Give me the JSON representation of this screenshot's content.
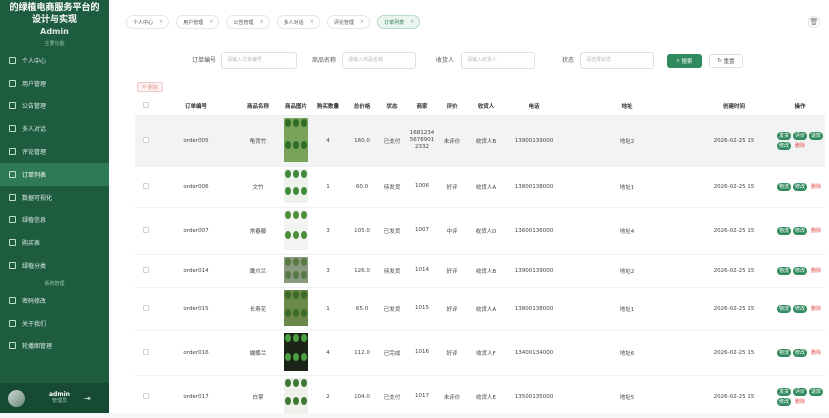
{
  "sidebar": {
    "title": "的绿植电商服务平台的设计与实现",
    "subtitle": "Admin",
    "section_main": "主要功能",
    "section_system": "系统管理",
    "items": [
      {
        "label": "个人中心",
        "icon": "user-icon"
      },
      {
        "label": "用户管理",
        "icon": "users-icon"
      },
      {
        "label": "公告管理",
        "icon": "notice-icon"
      },
      {
        "label": "多人对话",
        "icon": "chat-icon"
      },
      {
        "label": "评论管理",
        "icon": "comment-icon"
      },
      {
        "label": "订单列表",
        "icon": "order-icon"
      },
      {
        "label": "数据可视化",
        "icon": "chart-icon"
      },
      {
        "label": "绿植信息",
        "icon": "plant-icon"
      },
      {
        "label": "购买表",
        "icon": "cart-icon"
      },
      {
        "label": "绿植分类",
        "icon": "category-icon"
      }
    ],
    "system_items": [
      {
        "label": "密码修改",
        "icon": "lock-icon"
      },
      {
        "label": "关于我们",
        "icon": "info-icon"
      },
      {
        "label": "轮播图管理",
        "icon": "image-icon"
      }
    ],
    "user": {
      "name": "admin",
      "role": "管理员"
    }
  },
  "tabs": [
    {
      "label": "个人中心"
    },
    {
      "label": "用户管理"
    },
    {
      "label": "公告管理"
    },
    {
      "label": "多人对话"
    },
    {
      "label": "评论管理"
    },
    {
      "label": "订单列表"
    }
  ],
  "filters": {
    "order_no_label": "订单编号",
    "order_no_placeholder": "请输入订单编号",
    "product_label": "商品名称",
    "product_placeholder": "请输入商品名称",
    "receiver_label": "收货人",
    "receiver_placeholder": "请输入收货人",
    "status_label": "状态",
    "status_placeholder": "请选择状态",
    "search_label": "搜索",
    "reset_label": "重置",
    "delete_label": "删除"
  },
  "table": {
    "headers": [
      "",
      "订单编号",
      "商品名称",
      "商品图片",
      "购买数量",
      "总价格",
      "状态",
      "商家",
      "评价",
      "收货人",
      "电话",
      "地址",
      "创建时间",
      "操作"
    ],
    "rows": [
      {
        "order_no": "order005",
        "product": "龟背竹",
        "qty": "4",
        "total": "160.0",
        "status": "已支付",
        "merchant": "1681234 5678901 2332",
        "review": "未评价",
        "receiver": "收货人B",
        "phone": "13900139000",
        "address": "地址2",
        "created": "2026-02-25 15",
        "ops": [
          "发货",
          "评价",
          "退款",
          "修改",
          "删除"
        ]
      },
      {
        "order_no": "order006",
        "product": "文竹",
        "qty": "1",
        "total": "60.0",
        "status": "待发货",
        "merchant": "1006",
        "review": "好评",
        "receiver": "收货人A",
        "phone": "13800138000",
        "address": "地址1",
        "created": "2026-02-25 15",
        "ops": [
          "物流",
          "修改",
          "删除"
        ]
      },
      {
        "order_no": "order007",
        "product": "常春藤",
        "qty": "3",
        "total": "105.0",
        "status": "已发货",
        "merchant": "1007",
        "review": "中评",
        "receiver": "收货人D",
        "phone": "13600136000",
        "address": "地址4",
        "created": "2026-02-25 15",
        "ops": [
          "物流",
          "修改",
          "删除"
        ]
      },
      {
        "order_no": "order014",
        "product": "鹰爪兰",
        "qty": "3",
        "total": "126.0",
        "status": "待发货",
        "merchant": "1014",
        "review": "好评",
        "receiver": "收货人B",
        "phone": "13900139000",
        "address": "地址2",
        "created": "2026-02-25 15",
        "ops": [
          "物流",
          "修改",
          "删除"
        ]
      },
      {
        "order_no": "order015",
        "product": "长寿花",
        "qty": "1",
        "total": "65.0",
        "status": "已发货",
        "merchant": "1015",
        "review": "好评",
        "receiver": "收货人A",
        "phone": "13800138000",
        "address": "地址1",
        "created": "2026-02-25 15",
        "ops": [
          "物流",
          "修改",
          "删除"
        ]
      },
      {
        "order_no": "order016",
        "product": "蝴蝶兰",
        "qty": "4",
        "total": "112.0",
        "status": "已完成",
        "merchant": "1016",
        "review": "好评",
        "receiver": "收货人F",
        "phone": "13400134000",
        "address": "地址6",
        "created": "2026-02-25 15",
        "ops": [
          "物流",
          "修改",
          "删除"
        ]
      },
      {
        "order_no": "order017",
        "product": "白掌",
        "qty": "2",
        "total": "104.0",
        "status": "已支付",
        "merchant": "1017",
        "review": "未评价",
        "receiver": "收货人E",
        "phone": "13500135000",
        "address": "地址5",
        "created": "2026-02-25 15",
        "ops": [
          "发货",
          "评价",
          "退款",
          "修改",
          "删除"
        ]
      }
    ]
  },
  "colors": {
    "sidebar": "#1e5c40",
    "accent": "#2f8a5e",
    "danger": "#e24b4b"
  }
}
